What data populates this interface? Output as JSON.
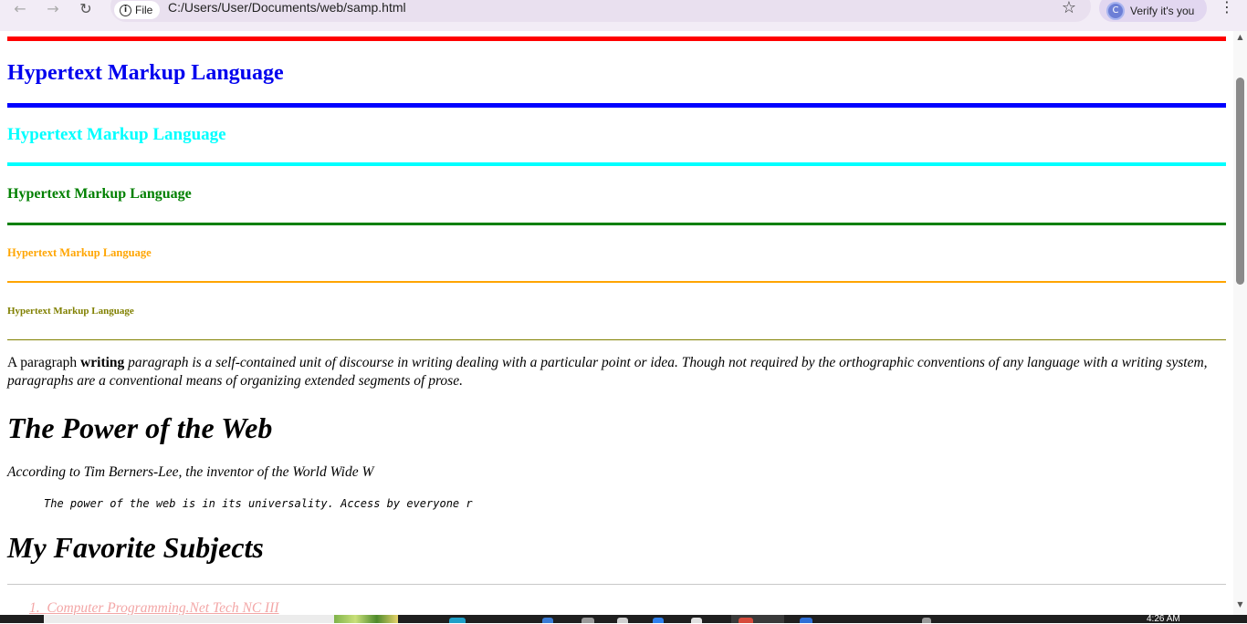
{
  "browser": {
    "back_icon": "arrow-left-icon",
    "forward_icon": "arrow-right-icon",
    "reload_icon": "reload-icon",
    "site_info_label": "File",
    "url": "C:/Users/User/Documents/web/samp.html",
    "bookmark_icon": "star-icon",
    "profile_initial": "C",
    "profile_label": "Verify it's you",
    "menu_icon": "kebab-menu-icon"
  },
  "page": {
    "headings": [
      {
        "text": "Hypertext Markup Language",
        "color": "#0000ee",
        "rule_color": "#ff0000"
      },
      {
        "text": "Hypertext Markup Language",
        "color": "#00ffff",
        "rule_color": "#0000ff"
      },
      {
        "text": "Hypertext Markup Language",
        "color": "#008000",
        "rule_color": "#00ffff"
      },
      {
        "text": "Hypertext Markup Language",
        "color": "#ffa500",
        "rule_color": "#008000"
      },
      {
        "text": "Hypertext Markup Language",
        "color": "#808000",
        "rule_color": "#ffa500"
      }
    ],
    "last_rule_color": "#808000",
    "paragraph": {
      "lead": "A paragraph ",
      "bold": "writing",
      "italic": " paragraph is a self-contained unit of discourse in writing dealing with a particular point or idea. Though not required by the orthographic conventions of any language with a writing system, paragraphs are a conventional means of organizing extended segments of prose."
    },
    "section1_title": "The Power of the Web",
    "citation": "According to Tim Berners-Lee, the inventor of the World Wide W",
    "quote": "The power of the web is in its universality. Access by everyone r",
    "section2_title": "My Favorite Subjects",
    "list_items": [
      "Computer Programming.Net Tech NC III"
    ]
  },
  "taskbar": {
    "clock": "4:26 AM"
  }
}
